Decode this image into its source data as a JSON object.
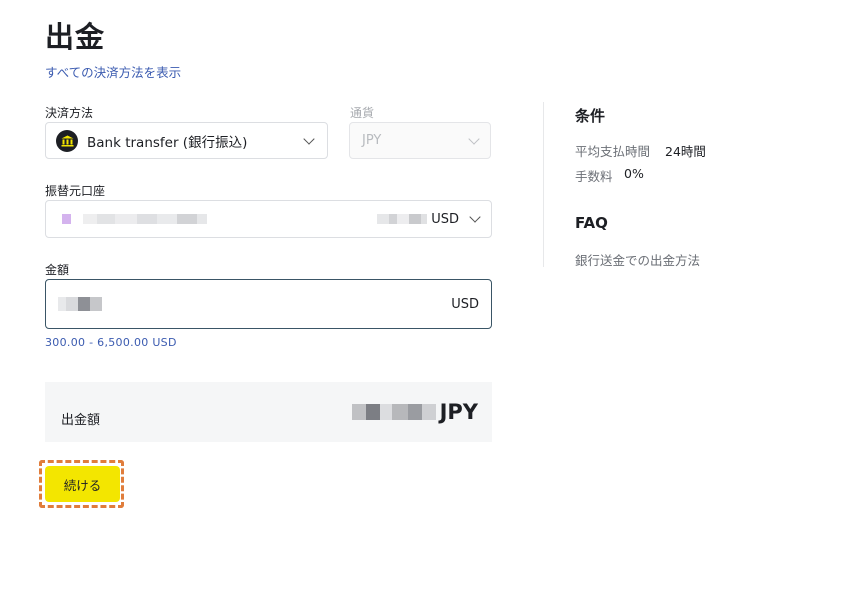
{
  "page": {
    "title": "出金",
    "all_methods_link": "すべての決済方法を表示"
  },
  "form": {
    "payment_method_label": "決済方法",
    "payment_method_value": "Bank transfer (銀行振込)",
    "currency_label": "通貨",
    "currency_value": "JPY",
    "source_account_label": "振替元口座",
    "source_account_currency": "USD",
    "amount_label": "金額",
    "amount_currency": "USD",
    "amount_range": "300.00 - 6,500.00 USD",
    "withdraw_amount_label": "出金額",
    "withdraw_amount_currency": "JPY",
    "continue_label": "続ける"
  },
  "sidebar": {
    "conditions_title": "条件",
    "avg_payout_time_label": "平均支払時間",
    "avg_payout_time_value": "24時間",
    "fee_label": "手数料",
    "fee_value": "0%",
    "faq_title": "FAQ",
    "faq_link": "銀行送金での出金方法"
  },
  "colors": {
    "accent_button": "#f3e600",
    "link": "#3b5bb0",
    "highlight_border": "#e07d3c"
  }
}
